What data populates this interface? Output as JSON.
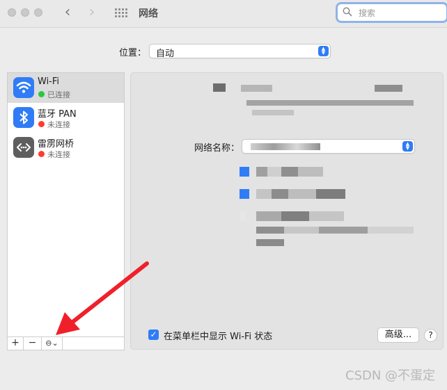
{
  "window": {
    "title": "网络"
  },
  "toolbar": {
    "back_icon": "‹",
    "forward_icon": "›",
    "search_placeholder": "搜索"
  },
  "location": {
    "label": "位置：",
    "value": "自动"
  },
  "services": [
    {
      "name": "Wi-Fi",
      "status": "已连接",
      "status_color": "#28c840",
      "icon": "wifi-icon",
      "selected": true
    },
    {
      "name": "蓝牙 PAN",
      "status": "未连接",
      "status_color": "#ff3b30",
      "icon": "bluetooth-icon",
      "selected": false
    },
    {
      "name": "雷雳网桥",
      "status": "未连接",
      "status_color": "#ff3b30",
      "icon": "thunderbolt-bridge-icon",
      "selected": false
    }
  ],
  "sidebar_toolbar": {
    "add": "+",
    "remove": "−",
    "action": "⊖⌄"
  },
  "detail": {
    "network_name_label": "网络名称：",
    "show_status_label": "在菜单栏中显示 Wi-Fi 状态",
    "show_status_checked": true,
    "advanced_label": "高级...",
    "help_label": "?"
  },
  "watermark": "CSDN @不蛋定",
  "colors": {
    "accent": "#2f7cf6",
    "annotation_arrow": "#f0202a"
  }
}
